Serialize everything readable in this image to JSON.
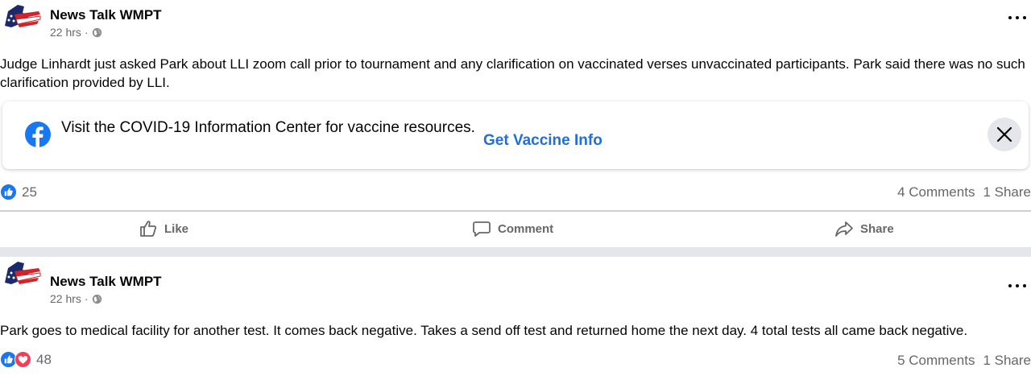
{
  "posts": [
    {
      "page_name": "News Talk WMPT",
      "time": "22 hrs",
      "separator": "·",
      "text": "Judge Linhardt just asked Park about LLI zoom call prior to tournament and any clarification on vaccinated verses unvaccinated participants. Park said there was no such clarification provided by LLI.",
      "covid_notice": {
        "text": "Visit the COVID-19 Information Center for vaccine resources.",
        "link": "Get Vaccine Info"
      },
      "reaction_count": "25",
      "comments": "4 Comments",
      "shares": "1 Share",
      "actions": {
        "like": "Like",
        "comment": "Comment",
        "share": "Share"
      }
    },
    {
      "page_name": "News Talk WMPT",
      "time": "22 hrs",
      "separator": "·",
      "text": "Park goes to medical facility for another test. It comes back negative. Takes a send off test and returned home the next day. 4 total tests all came back negative.",
      "reaction_count": "48",
      "comments": "5 Comments",
      "shares": "1 Share"
    }
  ],
  "colors": {
    "brand_blue": "#1877f2",
    "link_blue": "#216fdb",
    "love_red": "#f33e58",
    "secondary_text": "#65676b"
  },
  "icons": [
    "page-avatar-icon",
    "globe-icon",
    "more-options-icon",
    "facebook-logo-icon",
    "close-icon",
    "like-reaction-icon",
    "love-reaction-icon",
    "thumbs-up-icon",
    "comment-bubble-icon",
    "share-arrow-icon"
  ]
}
